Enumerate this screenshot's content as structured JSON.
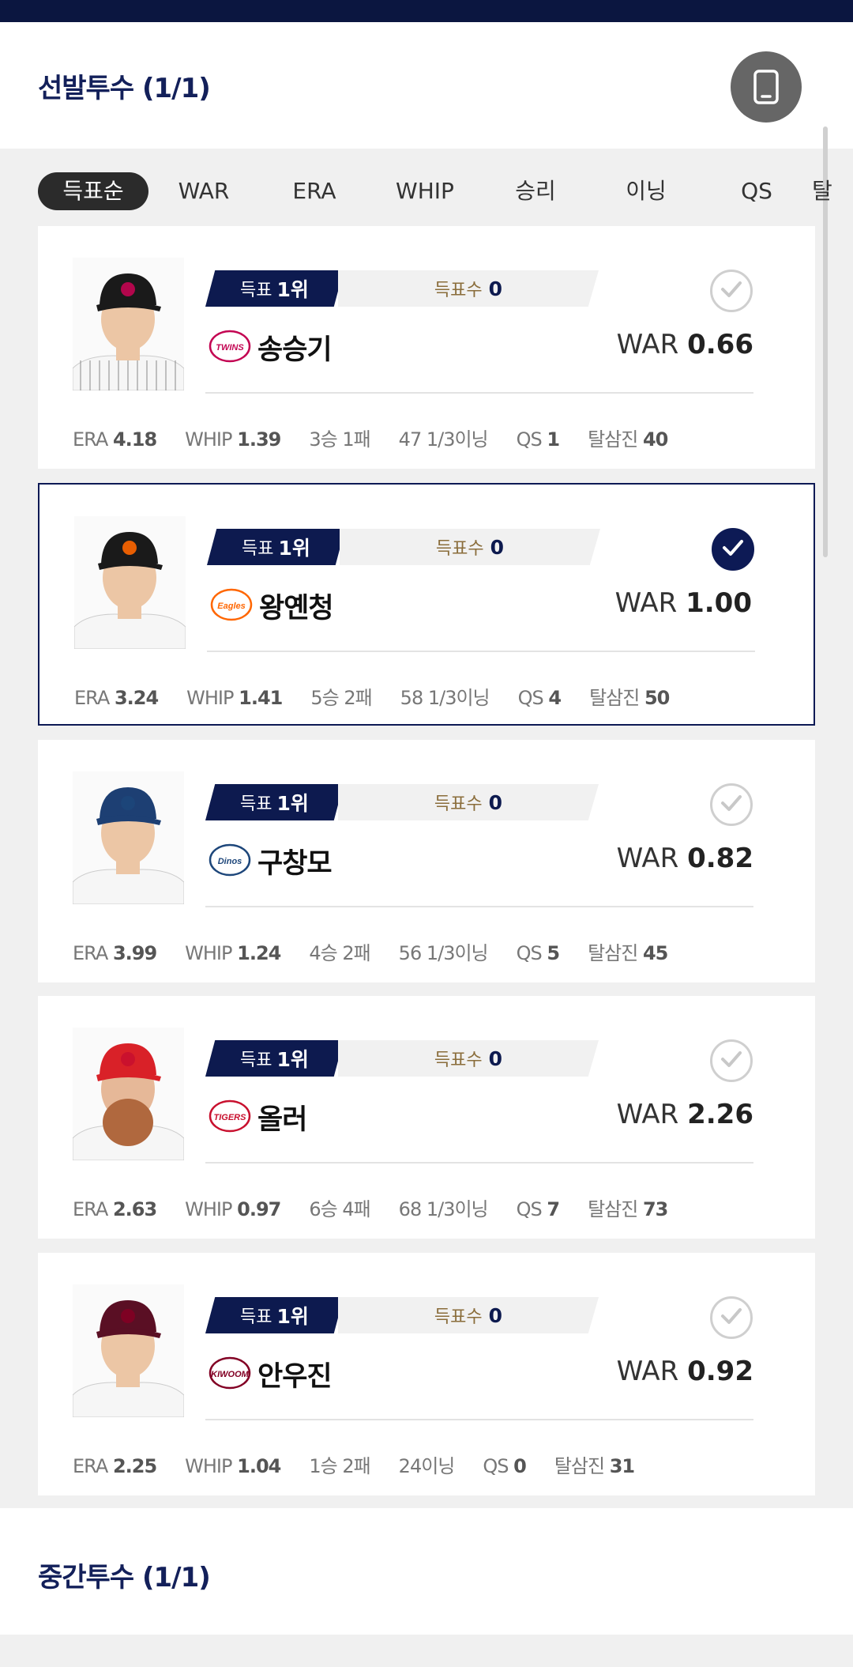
{
  "section1": {
    "title": "선발투수 (1/1)",
    "phone_icon": "mobile-phone-icon"
  },
  "tabs": [
    "득표순",
    "WAR",
    "ERA",
    "WHIP",
    "승리",
    "이닝",
    "QS",
    "탈"
  ],
  "players": [
    {
      "rank_label": "득표",
      "rank_value": "1위",
      "votes_label": "득표수",
      "votes_value": "0",
      "team": "TWINS",
      "team_color": "#c30452",
      "name": "송승기",
      "war_label": "WAR",
      "war_value": "0.66",
      "selected": false,
      "stats": {
        "era_label": "ERA",
        "era": "4.18",
        "whip_label": "WHIP",
        "whip": "1.39",
        "record": "3승 1패",
        "innings": "47 1/3이닝",
        "qs_label": "QS",
        "qs": "1",
        "k_label": "탈삼진",
        "k": "40"
      },
      "cap_color": "#1a1a1a",
      "jersey": "pinstripe-white"
    },
    {
      "rank_label": "득표",
      "rank_value": "1위",
      "votes_label": "득표수",
      "votes_value": "0",
      "team": "Eagles",
      "team_color": "#ff6600",
      "name": "왕옌청",
      "war_label": "WAR",
      "war_value": "1.00",
      "selected": true,
      "stats": {
        "era_label": "ERA",
        "era": "3.24",
        "whip_label": "WHIP",
        "whip": "1.41",
        "record": "5승 2패",
        "innings": "58 1/3이닝",
        "qs_label": "QS",
        "qs": "4",
        "k_label": "탈삼진",
        "k": "50"
      },
      "cap_color": "#1a1a1a",
      "jersey": "white"
    },
    {
      "rank_label": "득표",
      "rank_value": "1위",
      "votes_label": "득표수",
      "votes_value": "0",
      "team": "Dinos",
      "team_color": "#1d467a",
      "name": "구창모",
      "war_label": "WAR",
      "war_value": "0.82",
      "selected": false,
      "stats": {
        "era_label": "ERA",
        "era": "3.99",
        "whip_label": "WHIP",
        "whip": "1.24",
        "record": "4승 2패",
        "innings": "56 1/3이닝",
        "qs_label": "QS",
        "qs": "5",
        "k_label": "탈삼진",
        "k": "45"
      },
      "cap_color": "#1d3f73",
      "jersey": "white"
    },
    {
      "rank_label": "득표",
      "rank_value": "1위",
      "votes_label": "득표수",
      "votes_value": "0",
      "team": "TIGERS",
      "team_color": "#c8102e",
      "name": "올러",
      "war_label": "WAR",
      "war_value": "2.26",
      "selected": false,
      "stats": {
        "era_label": "ERA",
        "era": "2.63",
        "whip_label": "WHIP",
        "whip": "0.97",
        "record": "6승 4패",
        "innings": "68 1/3이닝",
        "qs_label": "QS",
        "qs": "7",
        "k_label": "탈삼진",
        "k": "73"
      },
      "cap_color": "#d92128",
      "jersey": "white"
    },
    {
      "rank_label": "득표",
      "rank_value": "1위",
      "votes_label": "득표수",
      "votes_value": "0",
      "team": "KIWOOM",
      "team_color": "#820024",
      "name": "안우진",
      "war_label": "WAR",
      "war_value": "0.92",
      "selected": false,
      "stats": {
        "era_label": "ERA",
        "era": "2.25",
        "whip_label": "WHIP",
        "whip": "1.04",
        "record": "1승 2패",
        "innings": "24이닝",
        "qs_label": "QS",
        "qs": "0",
        "k_label": "탈삼진",
        "k": "31"
      },
      "cap_color": "#5a0f24",
      "jersey": "white"
    }
  ],
  "section2": {
    "title": "중간투수 (1/1)"
  }
}
